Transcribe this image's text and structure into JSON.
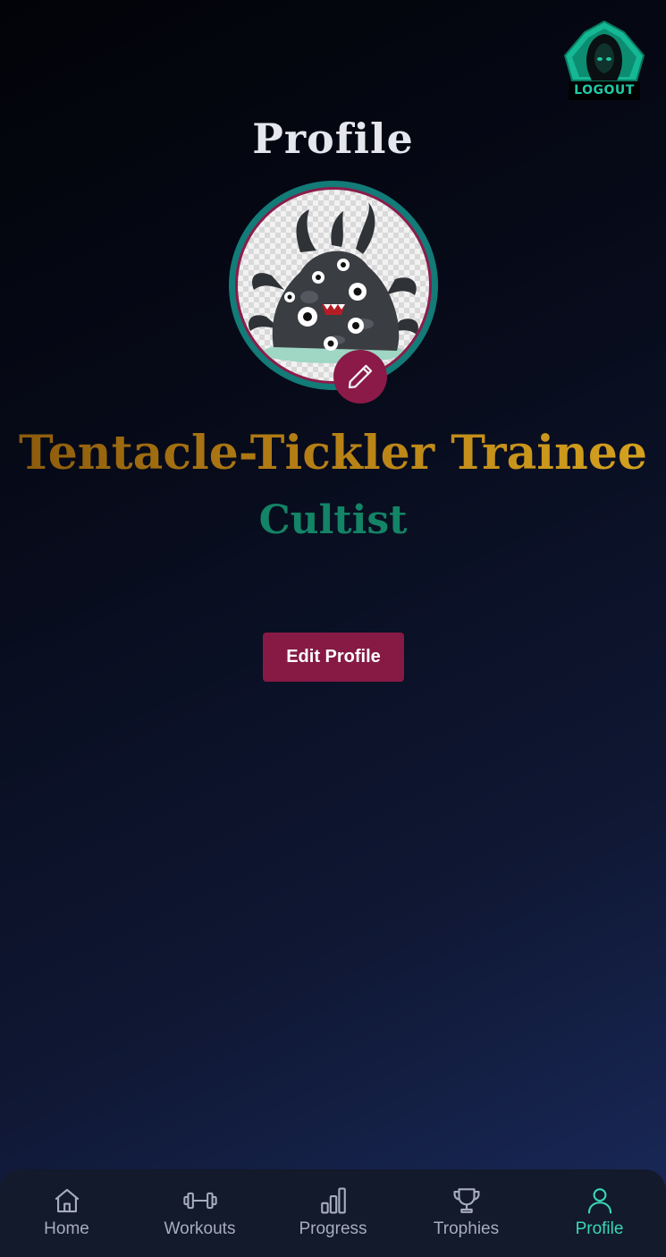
{
  "header": {
    "logout_label": "LOGOUT",
    "logout_icon": "hooded-cultist-icon"
  },
  "page": {
    "title": "Profile"
  },
  "profile": {
    "avatar": "tentacle-monster-avatar",
    "rank_title": "Tentacle-Tickler Trainee",
    "rank_class": "Cultist",
    "edit_button_label": "Edit Profile"
  },
  "bottom_nav": {
    "items": [
      {
        "label": "Home",
        "icon": "home-icon",
        "active": false
      },
      {
        "label": "Workouts",
        "icon": "dumbbell-icon",
        "active": false
      },
      {
        "label": "Progress",
        "icon": "bar-chart-icon",
        "active": false
      },
      {
        "label": "Trophies",
        "icon": "trophy-icon",
        "active": false
      },
      {
        "label": "Profile",
        "icon": "user-icon",
        "active": true
      }
    ]
  },
  "colors": {
    "accent_teal": "#1fc9a5",
    "accent_crimson": "#861a44",
    "rank_gold": "#c08a18",
    "class_green": "#138466",
    "nav_bg": "#121a2b"
  }
}
